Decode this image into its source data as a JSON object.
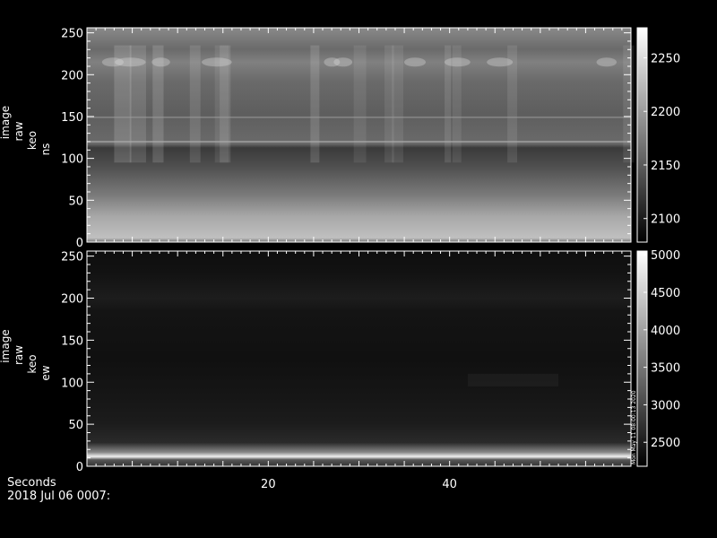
{
  "chart_data": [
    {
      "type": "heatmap",
      "ylabel_lines": [
        "image",
        "raw",
        "keo",
        "ns"
      ],
      "xlim": [
        0,
        60
      ],
      "ylim": [
        0,
        256
      ],
      "yticks": [
        0,
        50,
        100,
        150,
        200,
        250
      ],
      "colorbar": {
        "ticks": [
          2100,
          2150,
          2200,
          2250
        ],
        "range": [
          2078,
          2278
        ]
      },
      "grid": false,
      "colormap": "grayscale"
    },
    {
      "type": "heatmap",
      "ylabel_lines": [
        "image",
        "raw",
        "keo",
        "ew"
      ],
      "xlim": [
        0,
        60
      ],
      "ylim": [
        0,
        256
      ],
      "yticks": [
        0,
        50,
        100,
        150,
        200,
        250
      ],
      "colorbar": {
        "ticks": [
          2500,
          3000,
          3500,
          4000,
          4500,
          5000
        ],
        "range": [
          2180,
          5050
        ],
        "side_note": "Mon May 11 08:00:13 2020"
      },
      "xticks": [
        20,
        40
      ],
      "grid": false,
      "colormap": "grayscale"
    }
  ],
  "footer": {
    "xaxis_title": "Seconds",
    "date_label": "2018 Jul 06 0007:"
  }
}
